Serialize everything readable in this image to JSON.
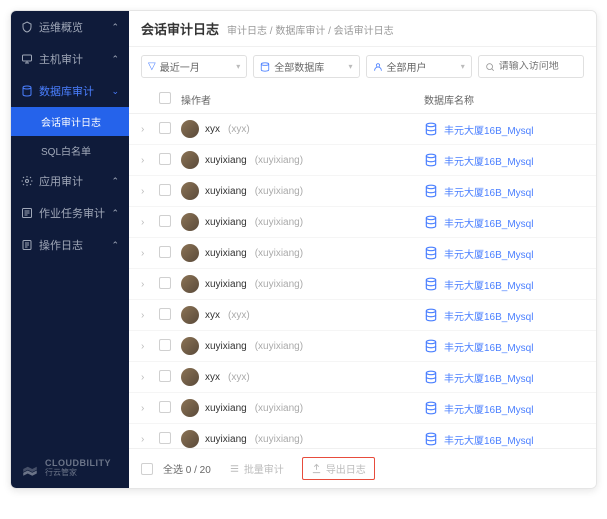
{
  "sidebar": {
    "items": [
      {
        "label": "运维概览"
      },
      {
        "label": "主机审计"
      },
      {
        "label": "数据库审计",
        "active": true,
        "children": [
          {
            "label": "会话审计日志",
            "selected": true
          },
          {
            "label": "SQL白名单"
          }
        ]
      },
      {
        "label": "应用审计"
      },
      {
        "label": "作业任务审计"
      },
      {
        "label": "操作日志"
      }
    ],
    "brand": {
      "name": "CLOUDBILITY",
      "sub": "行云管家"
    }
  },
  "header": {
    "title": "会话审计日志",
    "breadcrumb": "审计日志 / 数据库审计 / 会话审计日志"
  },
  "filters": {
    "time": "最近一月",
    "db": "全部数据库",
    "user": "全部用户",
    "search_placeholder": "请输入访问地"
  },
  "table": {
    "col_op": "操作者",
    "col_db": "数据库名称",
    "rows": [
      {
        "name": "xyx",
        "login": "(xyx)",
        "db": "丰元大厦16B_Mysql"
      },
      {
        "name": "xuyixiang",
        "login": "(xuyixiang)",
        "db": "丰元大厦16B_Mysql"
      },
      {
        "name": "xuyixiang",
        "login": "(xuyixiang)",
        "db": "丰元大厦16B_Mysql"
      },
      {
        "name": "xuyixiang",
        "login": "(xuyixiang)",
        "db": "丰元大厦16B_Mysql"
      },
      {
        "name": "xuyixiang",
        "login": "(xuyixiang)",
        "db": "丰元大厦16B_Mysql"
      },
      {
        "name": "xuyixiang",
        "login": "(xuyixiang)",
        "db": "丰元大厦16B_Mysql"
      },
      {
        "name": "xyx",
        "login": "(xyx)",
        "db": "丰元大厦16B_Mysql"
      },
      {
        "name": "xuyixiang",
        "login": "(xuyixiang)",
        "db": "丰元大厦16B_Mysql"
      },
      {
        "name": "xyx",
        "login": "(xyx)",
        "db": "丰元大厦16B_Mysql"
      },
      {
        "name": "xuyixiang",
        "login": "(xuyixiang)",
        "db": "丰元大厦16B_Mysql"
      },
      {
        "name": "xuyixiang",
        "login": "(xuyixiang)",
        "db": "丰元大厦16B_Mysql"
      }
    ]
  },
  "footer": {
    "select_all": "全选 0 / 20",
    "batch": "批量审计",
    "export": "导出日志"
  }
}
